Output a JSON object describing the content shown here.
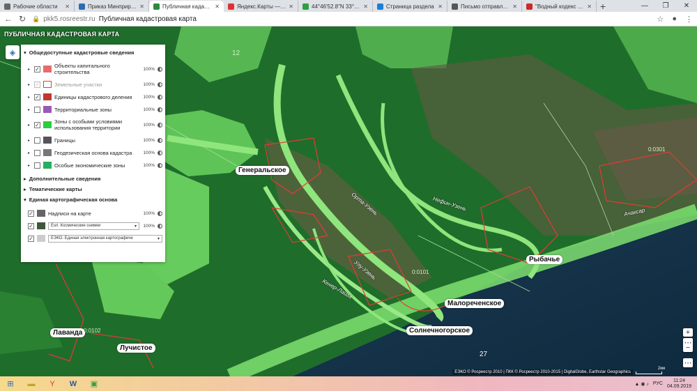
{
  "browser": {
    "tabs": [
      {
        "title": "Рабочие области",
        "color": "#666",
        "active": false
      },
      {
        "title": "Приказ Минприроды Ро",
        "color": "#2b6cb0",
        "active": false
      },
      {
        "title": "Публичная кадастровая",
        "color": "#2b8a3e",
        "active": true
      },
      {
        "title": "Яндекс.Карты — выбирай",
        "color": "#e03131",
        "active": false
      },
      {
        "title": "44°46'52.8\"N 33°55'27.1\"E",
        "color": "#2f9e44",
        "active": false
      },
      {
        "title": "Страница раздела",
        "color": "#1c7ed6",
        "active": false
      },
      {
        "title": "Письмо отправлено - По",
        "color": "#555",
        "active": false
      },
      {
        "title": "\"Водный кодекс Российс",
        "color": "#c92a2a",
        "active": false
      }
    ],
    "new_tab": "+",
    "window_controls": {
      "minimize": "—",
      "maximize": "❐",
      "close": "✕"
    },
    "url_host": "pkk5.rosreestr.ru",
    "page_title": "Публичная кадастровая карта"
  },
  "map": {
    "header": "ПУБЛИЧНАЯ КАДАСТРОВАЯ КАРТА",
    "places": [
      {
        "name": "Генеральское"
      },
      {
        "name": "Рыбачье"
      },
      {
        "name": "Малореченское"
      },
      {
        "name": "Солнечногорское"
      },
      {
        "name": "Лаванда"
      },
      {
        "name": "Лучистое"
      }
    ],
    "rivers": [
      "Орта-Узень",
      "Нефин-Узень",
      "Улу-Узень",
      "Кенер-Лаига",
      "Ачаксар"
    ],
    "numbers": [
      "12",
      "27",
      "0:0301",
      "0:0101",
      "0:0102"
    ],
    "attribution": "ЕЭКО © Росреестр 2010 | ПКК © Росреестр 2010-2015 | DigitalGlobe, Earthstar Geographics",
    "scale_label": "2км",
    "zoom_in": "+",
    "zoom_out": "−",
    "extra_btn": "⋯"
  },
  "panel": {
    "section1": "Общедоступные кадастровые сведения",
    "layers": [
      {
        "label": "Объекты капитального строительства",
        "pct": "100%",
        "checked": "✓",
        "swatch": "#e86b6b",
        "disabled": false,
        "tall": true
      },
      {
        "label": "Земельные участки",
        "pct": "100%",
        "checked": "✓",
        "swatch": "#fff",
        "disabled": true,
        "tall": false
      },
      {
        "label": "Единицы кадастрового деления",
        "pct": "100%",
        "checked": "✓",
        "swatch": "#c0392b",
        "disabled": false,
        "tall": false
      },
      {
        "label": "Территориальные зоны",
        "pct": "100%",
        "checked": "",
        "swatch": "#9b59b6",
        "disabled": false,
        "tall": false
      },
      {
        "label": "Зоны с особыми условиями использования территории",
        "pct": "100%",
        "checked": "✓",
        "swatch": "#2ecc40",
        "disabled": false,
        "tall": true
      },
      {
        "label": "Границы",
        "pct": "100%",
        "checked": "",
        "swatch": "#555",
        "disabled": false,
        "tall": false
      },
      {
        "label": "Геодезическая основа кадастра",
        "pct": "100%",
        "checked": "",
        "swatch": "#777",
        "disabled": false,
        "tall": false
      },
      {
        "label": "Особые экономические зоны",
        "pct": "100%",
        "checked": "",
        "swatch": "#27ae60",
        "disabled": false,
        "tall": false
      }
    ],
    "section2": "Дополнительные сведения",
    "section3": "Тематические карты",
    "section4": "Единая картографическая основа",
    "base": [
      {
        "label": "Надписи на карте",
        "pct": "100%",
        "checked": "✓"
      },
      {
        "label": "Esri. Космические снимки",
        "pct": "100%",
        "checked": "✓"
      },
      {
        "label": "ЕЭКО. Единая электронная картографиче",
        "pct": "",
        "checked": "✓"
      }
    ]
  },
  "taskbar": {
    "lang": "РУС",
    "time": "11:24",
    "date": "04.09.2019"
  }
}
